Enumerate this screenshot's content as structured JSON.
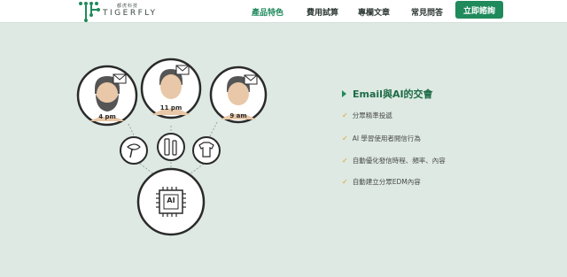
{
  "header": {
    "logo_small": "都虎科技",
    "logo_word": "TIGERFLY",
    "nav": [
      {
        "label": "產品特色",
        "active": true
      },
      {
        "label": "費用試算",
        "active": false
      },
      {
        "label": "專欄文章",
        "active": false
      },
      {
        "label": "常見問答",
        "active": false
      }
    ],
    "cta_label": "立即諮詢"
  },
  "illustration": {
    "avatars": [
      {
        "time": "4 pm"
      },
      {
        "time": "11 pm"
      },
      {
        "time": "9 am"
      }
    ],
    "chip_label": "AI"
  },
  "feature": {
    "title": "Email與AI的交會",
    "items": [
      "分眾精準投遞",
      "AI 學習使用者閱信行為",
      "自動優化發信時程、頻率、內容",
      "自動建立分眾EDM內容"
    ]
  },
  "colors": {
    "accent": "#1f8a5b",
    "background": "#dde9e2",
    "check": "#e29a1f"
  }
}
